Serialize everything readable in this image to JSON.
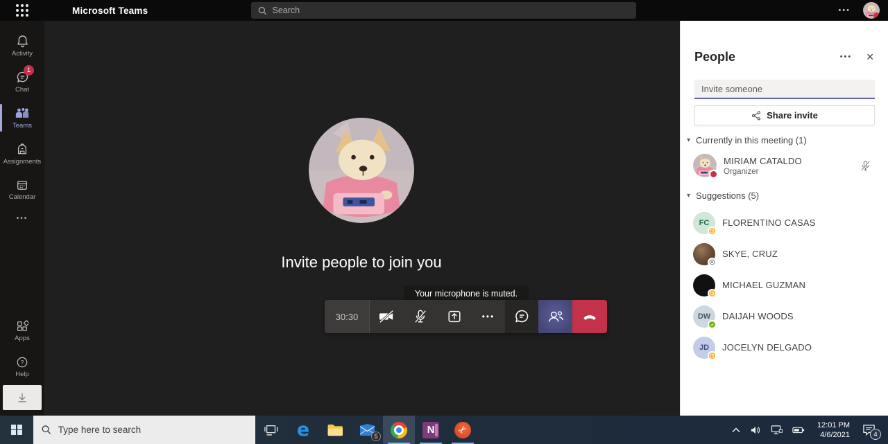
{
  "icons": {
    "dots": "•••",
    "caret_down": "▾",
    "close": "✕",
    "scissors": "✂"
  },
  "topbar": {
    "title": "Microsoft Teams",
    "search_placeholder": "Search"
  },
  "rail": {
    "items": [
      {
        "label": "Activity"
      },
      {
        "label": "Chat",
        "badge": "1"
      },
      {
        "label": "Teams"
      },
      {
        "label": "Assignments"
      },
      {
        "label": "Calendar"
      }
    ],
    "apps_label": "Apps",
    "help_label": "Help"
  },
  "stage": {
    "invite_heading": "Invite people to join you",
    "tooltip": "Your microphone is muted.",
    "timer": "30:30"
  },
  "people": {
    "title": "People",
    "invite_placeholder": "Invite someone",
    "share_invite": "Share invite",
    "section_current": "Currently in this meeting (1)",
    "section_suggestions": "Suggestions (5)",
    "organizer": {
      "name": "MIRIAM CATALDO",
      "role": "Organizer",
      "status": "busy",
      "muted": true
    },
    "suggestions": [
      {
        "name": "FLORENTINO CASAS",
        "initials": "FC",
        "status": "away"
      },
      {
        "name": "SKYE, CRUZ",
        "initials": "",
        "status": "offline"
      },
      {
        "name": "MICHAEL GUZMAN",
        "initials": "",
        "status": "away"
      },
      {
        "name": "DAIJAH WOODS",
        "initials": "DW",
        "status": "available"
      },
      {
        "name": "JOCELYN DELGADO",
        "initials": "JD",
        "status": "away"
      }
    ]
  },
  "taskbar": {
    "search_placeholder": "Type here to search",
    "mail_badge": "5",
    "clock": {
      "time": "12:01 PM",
      "date": "4/6/2021"
    },
    "notification_badge": "4"
  }
}
